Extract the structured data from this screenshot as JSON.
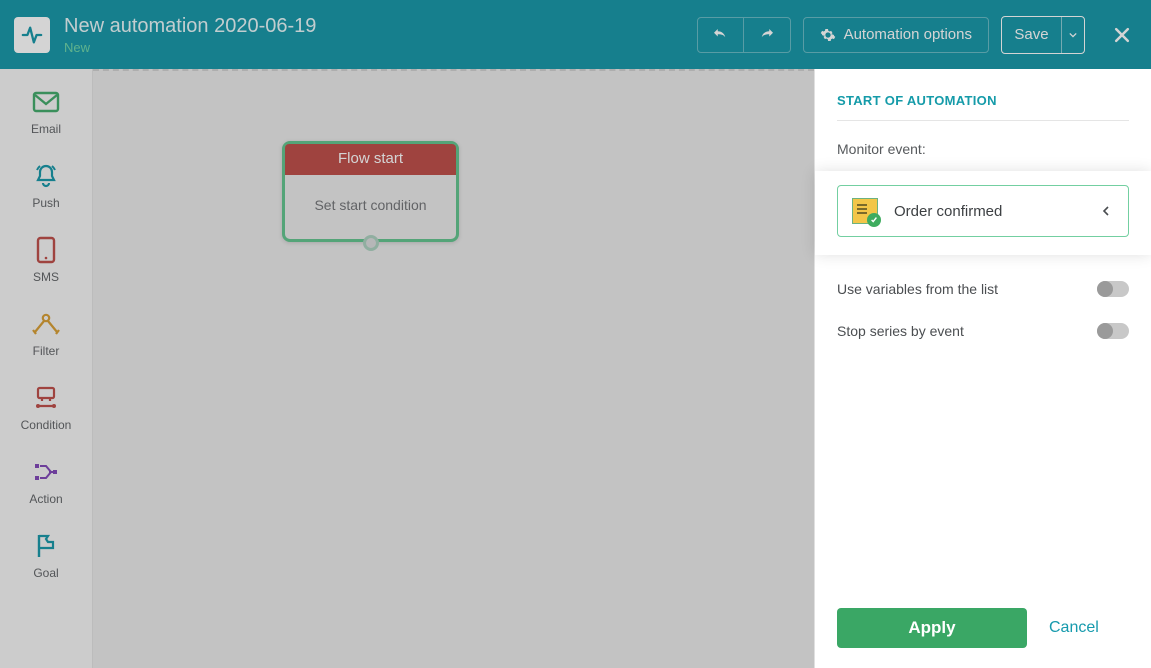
{
  "header": {
    "title": "New automation 2020-06-19",
    "status": "New",
    "options_label": "Automation options",
    "save_label": "Save"
  },
  "toolbar": {
    "items": [
      {
        "label": "Email",
        "icon": "email-icon"
      },
      {
        "label": "Push",
        "icon": "push-icon"
      },
      {
        "label": "SMS",
        "icon": "sms-icon"
      },
      {
        "label": "Filter",
        "icon": "filter-icon"
      },
      {
        "label": "Condition",
        "icon": "condition-icon"
      },
      {
        "label": "Action",
        "icon": "action-icon"
      },
      {
        "label": "Goal",
        "icon": "goal-icon"
      }
    ]
  },
  "flow_node": {
    "title": "Flow start",
    "body": "Set start condition"
  },
  "panel": {
    "heading": "START OF AUTOMATION",
    "monitor_label": "Monitor event:",
    "selected_event": "Order confirmed",
    "toggle_vars": "Use variables from the list",
    "toggle_stop": "Stop series by event",
    "apply": "Apply",
    "cancel": "Cancel"
  }
}
